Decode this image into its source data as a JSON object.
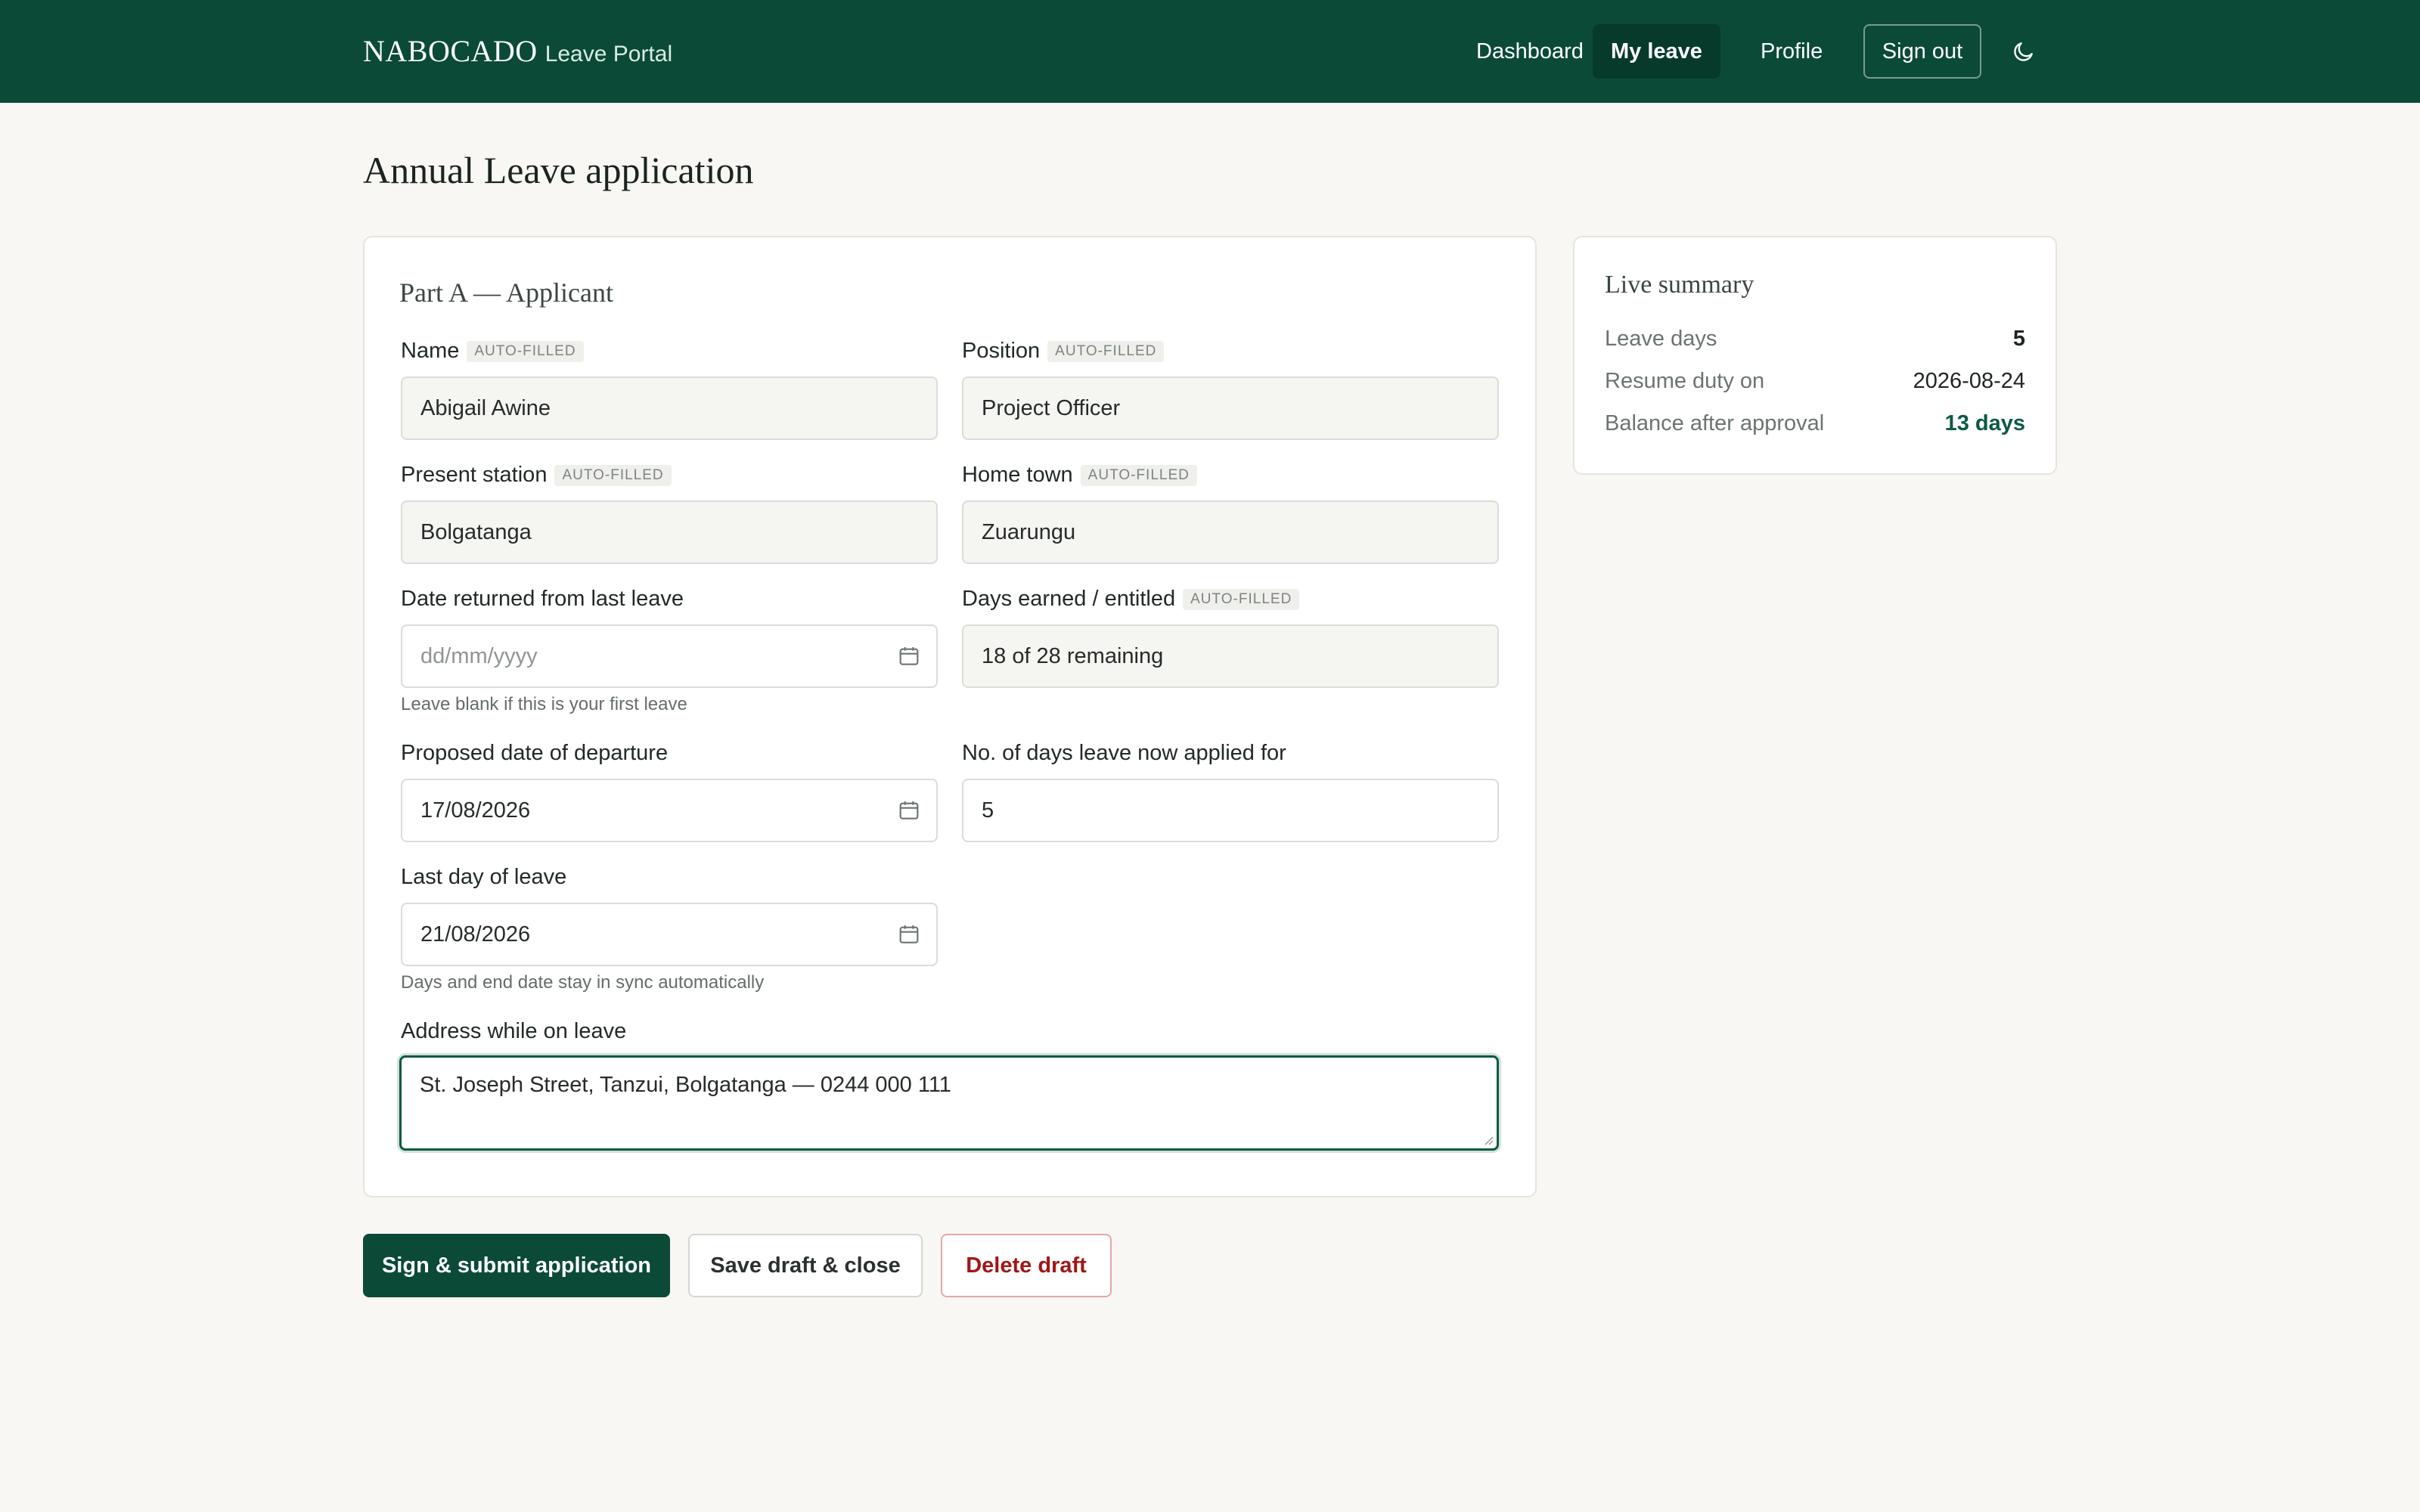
{
  "header": {
    "brand_name": "NABOCADO",
    "brand_sub": "Leave Portal",
    "nav": [
      "Dashboard",
      "My leave",
      "Profile"
    ],
    "active_nav": "My leave",
    "sign_out": "Sign out",
    "theme_icon": "moon-icon",
    "colors": {
      "bar": "#0b4a37",
      "active": "#073a2b"
    }
  },
  "page": {
    "title": "Annual Leave application"
  },
  "form": {
    "section_title": "Part A — Applicant",
    "auto_tag": "AUTO-FILLED",
    "name": {
      "label": "Name",
      "value": "Abigail Awine"
    },
    "position": {
      "label": "Position",
      "value": "Project Officer"
    },
    "station": {
      "label": "Present station",
      "value": "Bolgatanga"
    },
    "hometown": {
      "label": "Home town",
      "value": "Zuarungu"
    },
    "returned": {
      "label": "Date returned from last leave",
      "placeholder": "dd/mm/yyyy",
      "hint": "Leave blank if this is your first leave"
    },
    "days_earned": {
      "label": "Days earned / entitled",
      "value": "18 of 28 remaining"
    },
    "departure": {
      "label": "Proposed date of departure",
      "value": "17/08/2026"
    },
    "days_applied": {
      "label": "No. of days leave now applied for",
      "value": "5"
    },
    "last_day": {
      "label": "Last day of leave",
      "value": "21/08/2026",
      "hint": "Days and end date stay in sync automatically"
    },
    "address": {
      "label": "Address while on leave",
      "value": "St. Joseph Street, Tanzui, Bolgatanga — 0244 000 111"
    }
  },
  "actions": {
    "submit": "Sign & submit application",
    "save": "Save draft & close",
    "delete": "Delete draft"
  },
  "summary": {
    "title": "Live summary",
    "rows": [
      {
        "label": "Leave days",
        "value": "5"
      },
      {
        "label": "Resume duty on",
        "value": "2026-08-24"
      },
      {
        "label": "Balance after approval",
        "value": "13 days"
      }
    ]
  }
}
